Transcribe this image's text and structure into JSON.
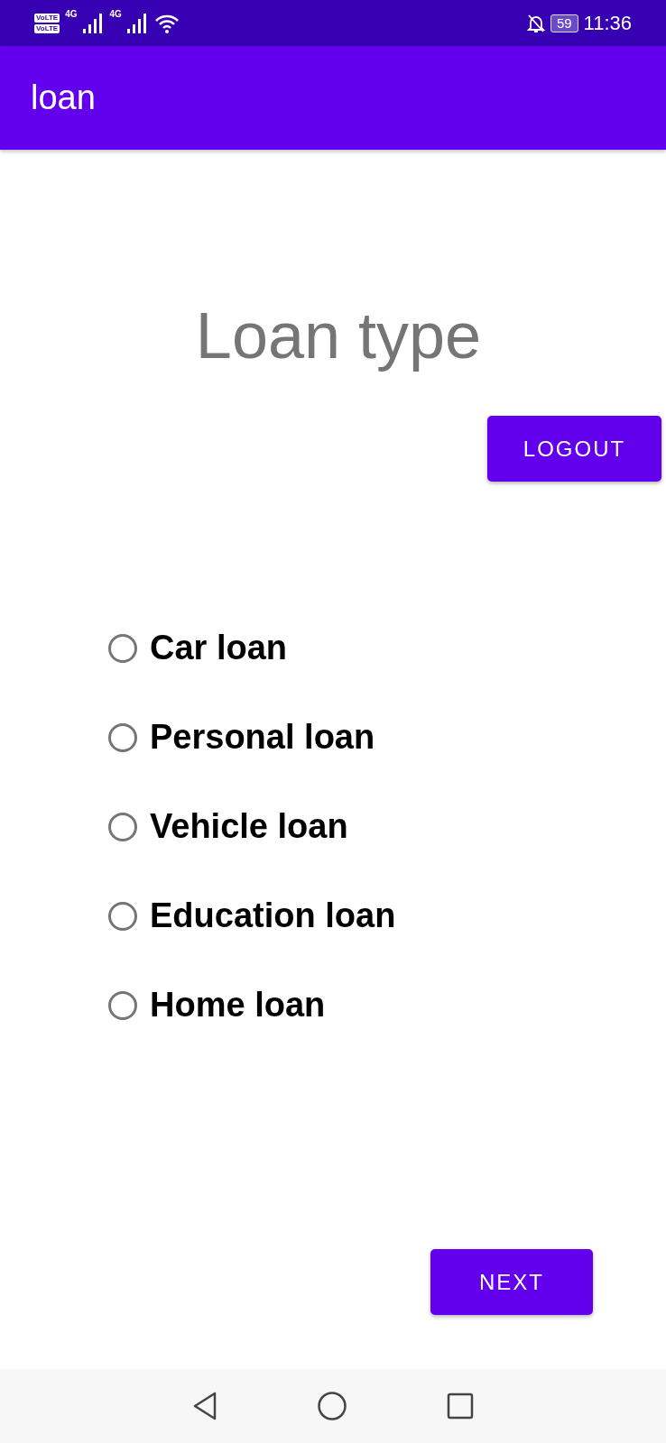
{
  "status_bar": {
    "sim_labels": [
      "VoLTE",
      "VoLTE"
    ],
    "network_labels": [
      "4G",
      "4G"
    ],
    "battery": "59",
    "time": "11:36"
  },
  "app_bar": {
    "title": "loan"
  },
  "heading": "Loan type",
  "logout_button": "LOGOUT",
  "options": [
    {
      "label": "Car loan",
      "selected": false
    },
    {
      "label": "Personal loan",
      "selected": false
    },
    {
      "label": "Vehicle loan",
      "selected": false
    },
    {
      "label": "Education loan",
      "selected": false
    },
    {
      "label": "Home loan",
      "selected": false
    }
  ],
  "next_button": "NEXT"
}
